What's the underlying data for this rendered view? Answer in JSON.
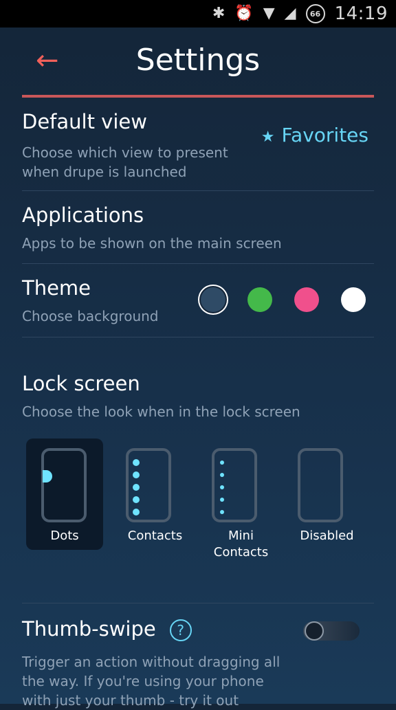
{
  "status": {
    "time": "14:19",
    "battery": "66"
  },
  "header": {
    "title": "Settings"
  },
  "default_view": {
    "title": "Default view",
    "subtitle": "Choose which view to present when drupe is launched",
    "value": "Favorites"
  },
  "applications": {
    "title": "Applications",
    "subtitle": "Apps to be shown on the main screen"
  },
  "theme": {
    "title": "Theme",
    "subtitle": "Choose background",
    "colors": [
      "#2f4b66",
      "#44b94a",
      "#f0508c",
      "#ffffff"
    ],
    "selected": "#2f4b66"
  },
  "lock": {
    "title": "Lock screen",
    "subtitle": "Choose the look when in the lock screen",
    "options": [
      "Dots",
      "Contacts",
      "Mini",
      "Contacts",
      "Disabled"
    ],
    "selected": "Dots"
  },
  "thumb": {
    "title": "Thumb-swipe",
    "help": "?",
    "subtitle": "Trigger an action without dragging all the way. If you're using your phone with just your thumb - try it out",
    "enabled": false
  }
}
